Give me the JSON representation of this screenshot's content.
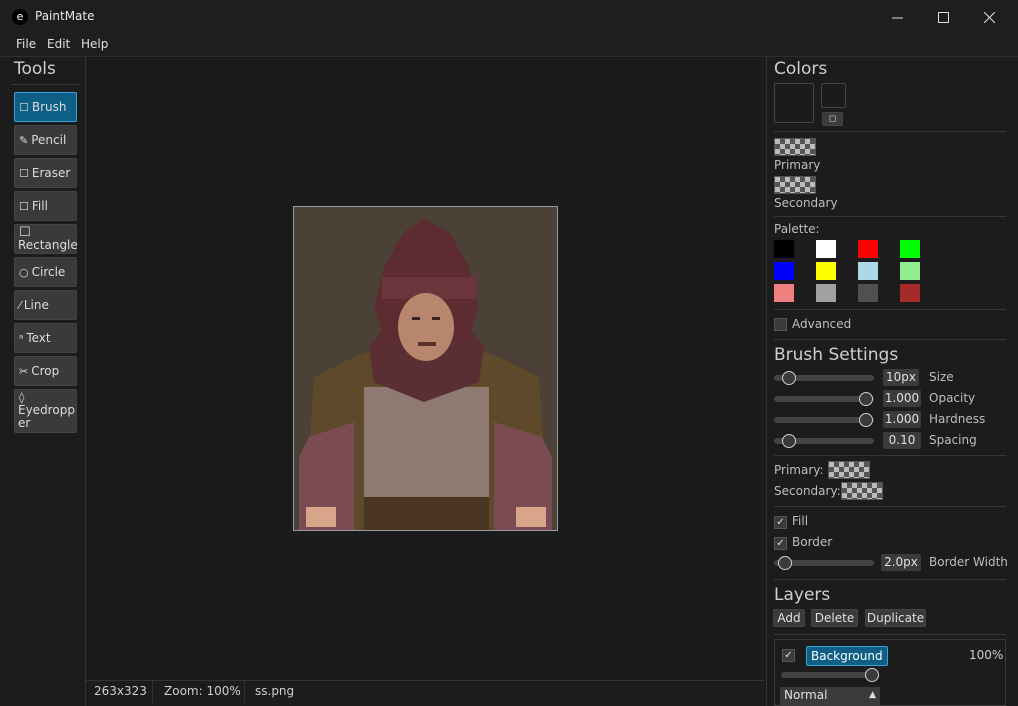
{
  "window": {
    "title": "PaintMate",
    "app_icon": "e"
  },
  "menu": {
    "file": "File",
    "edit": "Edit",
    "help": "Help"
  },
  "tools": {
    "title": "Tools",
    "items": [
      {
        "label": "Brush",
        "icon": "square-icon",
        "active": true
      },
      {
        "label": "Pencil",
        "icon": "pencil-icon"
      },
      {
        "label": "Eraser",
        "icon": "square-icon"
      },
      {
        "label": "Fill",
        "icon": "square-icon"
      },
      {
        "label": "Rectangle",
        "icon": "rectangle-icon"
      },
      {
        "label": "Circle",
        "icon": "circle-icon"
      },
      {
        "label": "Line",
        "icon": "line-icon"
      },
      {
        "label": "Text",
        "icon": "text-icon"
      },
      {
        "label": "Crop",
        "icon": "scissors-icon"
      },
      {
        "label": "Eyedropper",
        "icon": "droplet-icon"
      }
    ]
  },
  "status": {
    "size": "263x323",
    "zoom": "Zoom: 100%",
    "file": "ss.png"
  },
  "colors": {
    "title": "Colors",
    "primary_label": "Primary",
    "secondary_label": "Secondary",
    "palette_label": "Palette:",
    "palette": [
      "#000000",
      "#ffffff",
      "#ff0000",
      "#00ff00",
      "#0000ff",
      "#ffff00",
      "#add8e6",
      "#90ee90",
      "#f08080",
      "#a0a0a0",
      "#505050",
      "#a52a2a"
    ],
    "advanced_label": "Advanced"
  },
  "brush": {
    "title": "Brush Settings",
    "size_label": "Size",
    "size_value": "10px",
    "opacity_label": "Opacity",
    "opacity_value": "1.000",
    "hardness_label": "Hardness",
    "hardness_value": "1.000",
    "spacing_label": "Spacing",
    "spacing_value": "0.10",
    "primary_label": "Primary:",
    "secondary_label": "Secondary:",
    "fill_label": "Fill",
    "border_label": "Border",
    "border_width_label": "Border Width",
    "border_width_value": "2.0px"
  },
  "layers": {
    "title": "Layers",
    "add": "Add",
    "delete": "Delete",
    "duplicate": "Duplicate",
    "items": [
      {
        "name": "Background",
        "opacity": "100%",
        "blend": "Normal"
      }
    ]
  }
}
